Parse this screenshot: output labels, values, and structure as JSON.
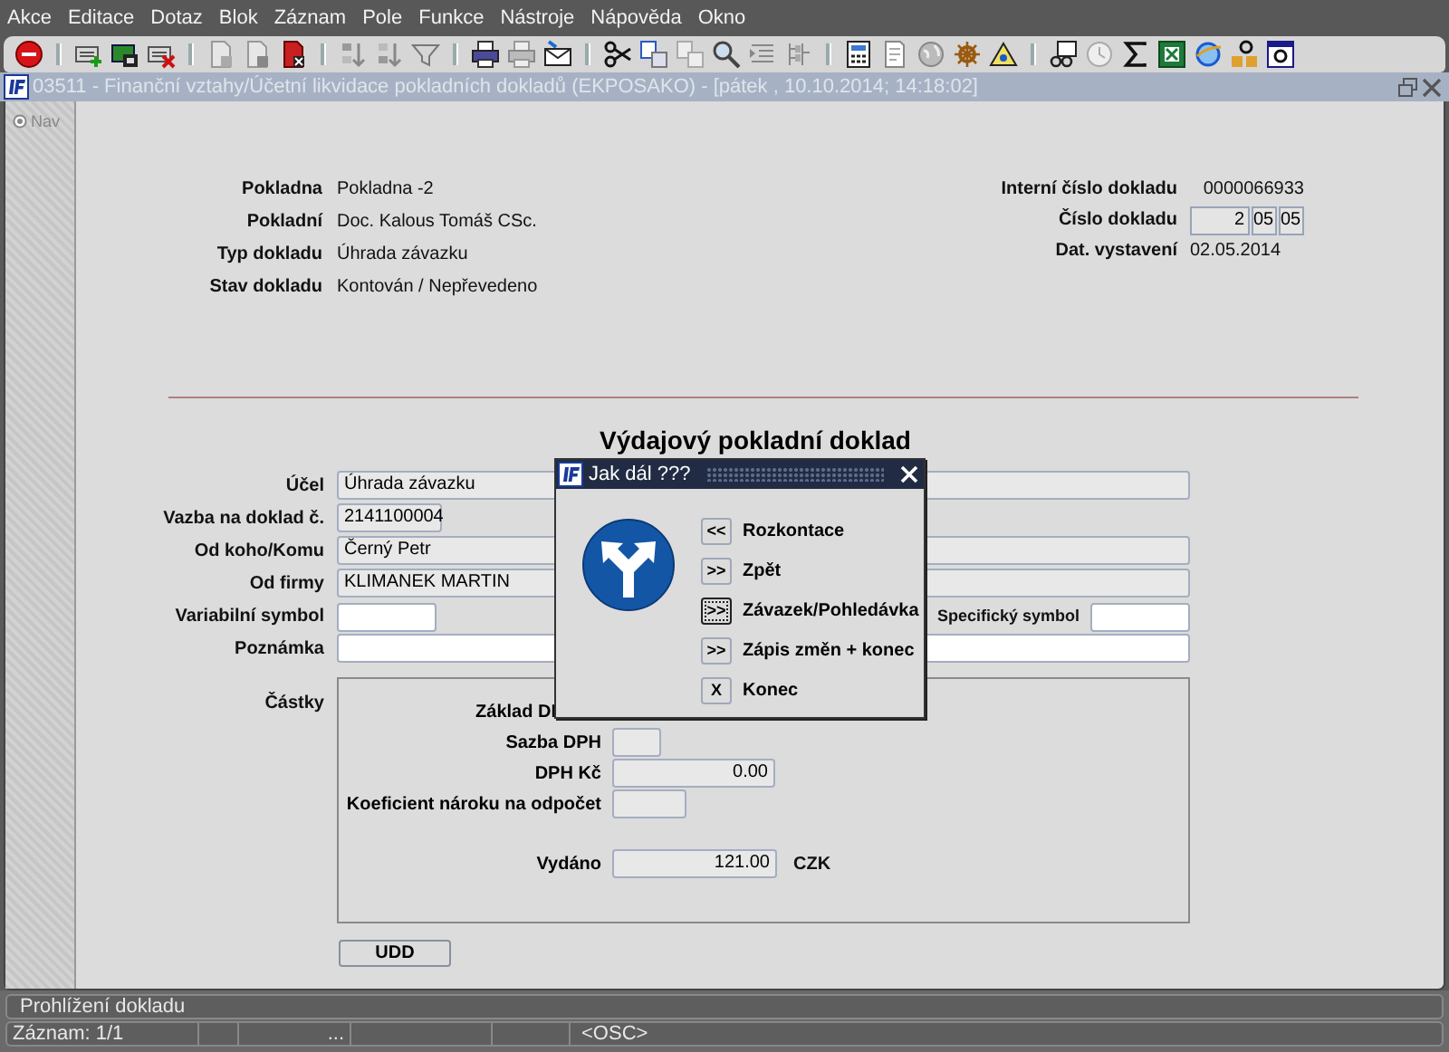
{
  "menu": [
    "Akce",
    "Editace",
    "Dotaz",
    "Blok",
    "Záznam",
    "Pole",
    "Funkce",
    "Nástroje",
    "Nápověda",
    "Okno"
  ],
  "window": {
    "title": "03511 - Finanční vztahy/Účetní likvidace pokladních dokladů (EKPOSAKO) - [pátek , 10.10.2014; 14:18:02]"
  },
  "nav": {
    "label": "Nav"
  },
  "header": {
    "left": [
      {
        "label": "Pokladna",
        "value": "Pokladna -2"
      },
      {
        "label": "Pokladní",
        "value": "Doc. Kalous Tomáš CSc."
      },
      {
        "label": "Typ dokladu",
        "value": "Úhrada závazku"
      },
      {
        "label": "Stav dokladu",
        "value": "Kontován / Nepřevedeno"
      }
    ],
    "right": [
      {
        "label": "Interní číslo dokladu",
        "kind": "number",
        "value": "0000066933"
      },
      {
        "label": "Číslo dokladu",
        "kind": "segments",
        "segments": [
          "2",
          "05",
          "05"
        ]
      },
      {
        "label": "Dat. vystavení",
        "kind": "date",
        "value": "02.05.2014"
      }
    ]
  },
  "form": {
    "title": "Výdajový pokladní doklad",
    "rows": [
      {
        "label": "Účel",
        "kind": "wide",
        "fields": [
          {
            "value": "Úhrada závazku",
            "editable": false
          }
        ]
      },
      {
        "label": "Vazba na doklad č.",
        "kind": "short",
        "fields": [
          {
            "value": "2141100004",
            "editable": false
          }
        ]
      },
      {
        "label": "Od koho/Komu",
        "kind": "wide",
        "fields": [
          {
            "value": "Černý Petr",
            "editable": false
          }
        ]
      },
      {
        "label": "Od firmy",
        "kind": "wide",
        "fields": [
          {
            "value": "KLIMANEK MARTIN",
            "editable": false
          }
        ]
      },
      {
        "label": "Variabilní symbol",
        "kind": "pair",
        "fields": [
          {
            "editable": true
          },
          {
            "label": "Specifický symbol",
            "editable": true
          }
        ]
      },
      {
        "label": "Poznámka",
        "kind": "wide",
        "fields": [
          {
            "editable": true
          }
        ]
      }
    ]
  },
  "amounts": {
    "label": "Částky",
    "rows": [
      {
        "label": "Základ DI",
        "kind": "covered"
      },
      {
        "label": "Sazba DPH",
        "kind": "small"
      },
      {
        "label": "DPH Kč",
        "kind": "amount",
        "value": "0.00"
      },
      {
        "label": "Koeficient nároku na odpočet",
        "kind": "medium"
      },
      {
        "label": "Vydáno",
        "kind": "total",
        "value": "121.00",
        "unit": "CZK"
      }
    ]
  },
  "udd_button": {
    "label": "UDD"
  },
  "dialog": {
    "title": "Jak dál ???",
    "options": [
      {
        "key": "<<",
        "label": "Rozkontace",
        "focused": false
      },
      {
        "key": ">>",
        "label": "Zpět",
        "focused": false
      },
      {
        "key": ">>",
        "label": "Závazek/Pohledávka",
        "focused": true
      },
      {
        "key": ">>",
        "label": "Zápis změn + konec",
        "focused": false
      },
      {
        "key": "X",
        "label": "Konec",
        "focused": false
      }
    ]
  },
  "status_bar": {
    "message": "Prohlížení dokladu",
    "record": "Záznam: 1/1",
    "more": "...",
    "mode": "<OSC>"
  }
}
